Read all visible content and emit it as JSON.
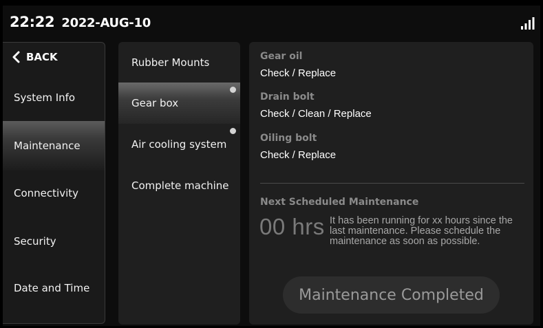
{
  "status_bar": {
    "time": "22:22",
    "date": "2022-AUG-10",
    "signal_icon": "signal-bars-icon"
  },
  "nav": {
    "back_label": "BACK",
    "items": [
      {
        "label": "System Info",
        "active": false
      },
      {
        "label": "Maintenance",
        "active": true
      },
      {
        "label": "Connectivity",
        "active": false
      },
      {
        "label": "Security",
        "active": false
      },
      {
        "label": "Date and Time",
        "active": false
      }
    ]
  },
  "components": {
    "items": [
      {
        "label": "Rubber Mounts",
        "active": false,
        "indicator": false
      },
      {
        "label": "Gear box",
        "active": true,
        "indicator": true
      },
      {
        "label": "Air cooling system",
        "active": false,
        "indicator": true
      },
      {
        "label": "Complete machine",
        "active": false,
        "indicator": false
      }
    ]
  },
  "detail": {
    "tasks": [
      {
        "heading": "Gear oil",
        "action": "Check / Replace"
      },
      {
        "heading": "Drain bolt",
        "action": "Check / Clean / Replace"
      },
      {
        "heading": "Oiling bolt",
        "action": "Check / Replace"
      }
    ],
    "next_maintenance": {
      "heading": "Next Scheduled Maintenance",
      "hours": "00 hrs",
      "note": "It has been running for xx hours since the last maintenance. Please schedule the maintenance as soon as possible."
    },
    "complete_button": "Maintenance Completed"
  },
  "colors": {
    "background": "#0d0d0d",
    "panel": "#1f1f1f",
    "muted_text": "#8a8a8a",
    "indicator": "#d4d4d4"
  }
}
